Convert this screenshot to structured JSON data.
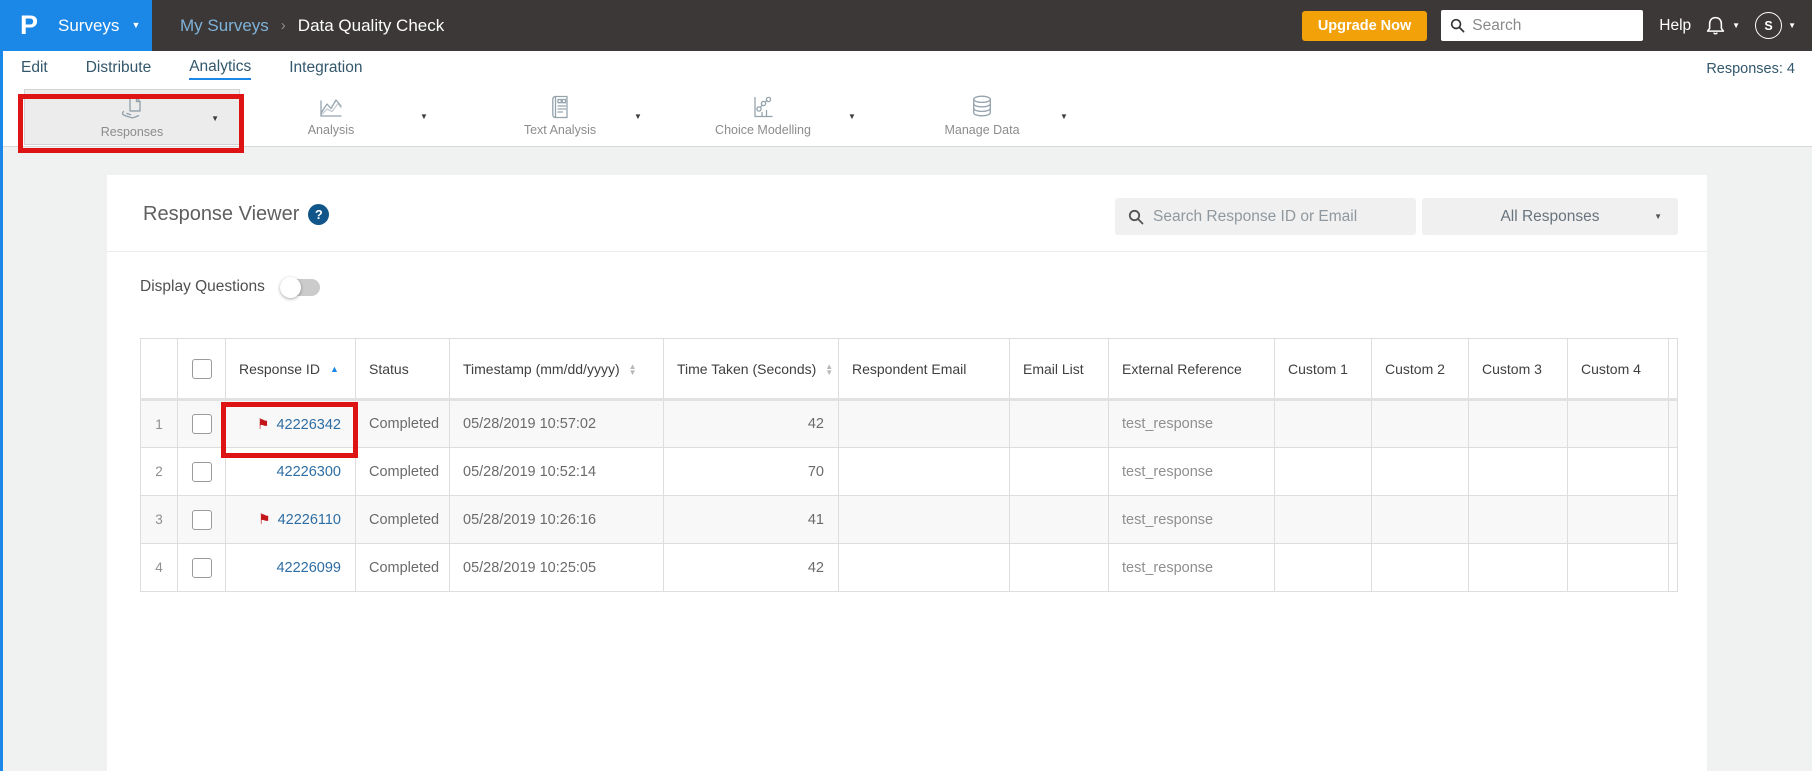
{
  "topbar": {
    "logo_letter": "P",
    "product_label": "Surveys",
    "breadcrumb_parent": "My Surveys",
    "breadcrumb_current": "Data Quality Check",
    "upgrade_label": "Upgrade Now",
    "search_placeholder": "Search",
    "help_label": "Help",
    "avatar_initial": "S"
  },
  "nav": {
    "tabs": [
      {
        "label": "Edit"
      },
      {
        "label": "Distribute"
      },
      {
        "label": "Analytics"
      },
      {
        "label": "Integration"
      }
    ],
    "active_tab": "Analytics",
    "responses_count": "Responses: 4"
  },
  "toolbar": {
    "items": [
      {
        "label": "Responses",
        "icon": "hand-report-icon",
        "selected": true,
        "annotated": true
      },
      {
        "label": "Analysis",
        "icon": "line-chart-icon",
        "selected": false
      },
      {
        "label": "Text Analysis",
        "icon": "document-grid-icon",
        "selected": false
      },
      {
        "label": "Choice Modelling",
        "icon": "scatter-chart-icon",
        "selected": false
      },
      {
        "label": "Manage Data",
        "icon": "database-icon",
        "selected": false
      }
    ]
  },
  "viewer": {
    "title": "Response Viewer",
    "search_placeholder": "Search Response ID or Email",
    "filter_value": "All Responses",
    "display_questions_label": "Display Questions",
    "display_questions_on": false
  },
  "table": {
    "columns": [
      "",
      "",
      "Response ID",
      "Status",
      "Timestamp (mm/dd/yyyy)",
      "Time Taken (Seconds)",
      "Respondent Email",
      "Email List",
      "External Reference",
      "Custom 1",
      "Custom 2",
      "Custom 3",
      "Custom 4",
      ""
    ],
    "sort": {
      "response_id": "asc",
      "timestamp": "sortable",
      "time_taken": "sortable"
    },
    "rows": [
      {
        "num": "1",
        "id": "42226342",
        "flagged": true,
        "annotated": true,
        "status": "Completed",
        "timestamp": "05/28/2019 10:57:02",
        "time_taken": "42",
        "respondent_email": "",
        "email_list": "",
        "external_reference": "test_response",
        "custom1": "",
        "custom2": "",
        "custom3": "",
        "custom4": ""
      },
      {
        "num": "2",
        "id": "42226300",
        "flagged": false,
        "annotated": false,
        "status": "Completed",
        "timestamp": "05/28/2019 10:52:14",
        "time_taken": "70",
        "respondent_email": "",
        "email_list": "",
        "external_reference": "test_response",
        "custom1": "",
        "custom2": "",
        "custom3": "",
        "custom4": ""
      },
      {
        "num": "3",
        "id": "42226110",
        "flagged": true,
        "annotated": false,
        "status": "Completed",
        "timestamp": "05/28/2019 10:26:16",
        "time_taken": "41",
        "respondent_email": "",
        "email_list": "",
        "external_reference": "test_response",
        "custom1": "",
        "custom2": "",
        "custom3": "",
        "custom4": ""
      },
      {
        "num": "4",
        "id": "42226099",
        "flagged": false,
        "annotated": false,
        "status": "Completed",
        "timestamp": "05/28/2019 10:25:05",
        "time_taken": "42",
        "respondent_email": "",
        "email_list": "",
        "external_reference": "test_response",
        "custom1": "",
        "custom2": "",
        "custom3": "",
        "custom4": ""
      }
    ]
  },
  "icons": {
    "caret_down": "▼",
    "breadcrumb_sep": "›",
    "flag": "⚑",
    "sort_asc": "▲",
    "sort_desc": "▼",
    "help_glyph": "?"
  },
  "colors": {
    "brand_blue": "#1b87e6",
    "topbar_dark": "#3b3837",
    "upgrade_orange": "#f2a109",
    "annotation_red": "#de1313",
    "link_blue": "#2d6da3",
    "flag_red": "#c2161b"
  }
}
